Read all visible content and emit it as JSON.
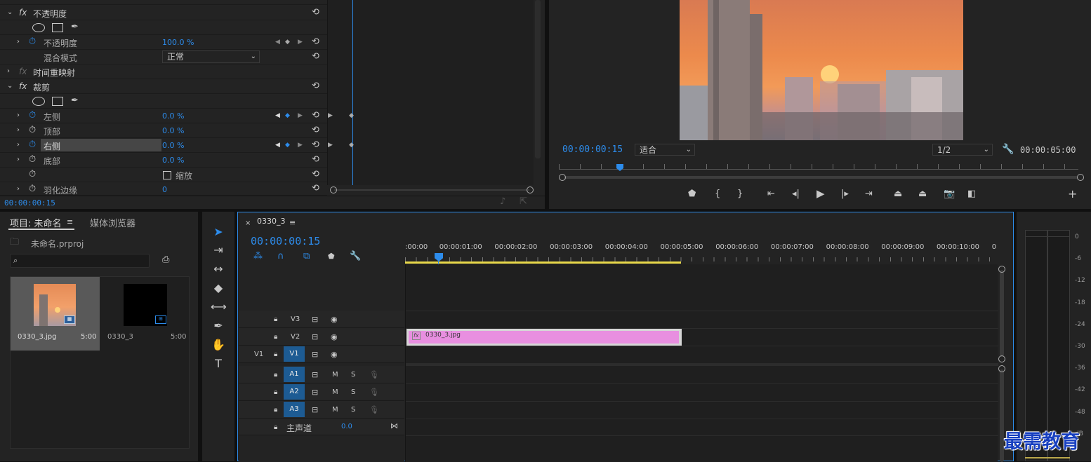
{
  "effects": {
    "top_cut_label": "时间重映射",
    "opacity_section": "不透明度",
    "opacity_label": "不透明度",
    "opacity_value": "100.0 %",
    "blend_label": "混合模式",
    "blend_value": "正常",
    "time_remap": "时间重映射",
    "crop_section": "裁剪",
    "left_label": "左侧",
    "left_value": "0.0 %",
    "top_label": "顶部",
    "top_value": "0.0 %",
    "right_label": "右侧",
    "right_value": "0.0 %",
    "bottom_label": "底部",
    "bottom_value": "0.0 %",
    "zoom_label": "缩放",
    "feather_label": "羽化边缘",
    "feather_value": "0",
    "timecode": "00:00:00:15",
    "fx": "fx"
  },
  "monitor": {
    "timecode": "00:00:00:15",
    "fit": "适合",
    "resolution": "1/2",
    "duration": "00:00:05:00"
  },
  "project": {
    "tab_project": "项目: 未命名",
    "tab_media": "媒体浏览器",
    "file": "未命名.prproj",
    "item1_name": "0330_3.jpg",
    "item1_dur": "5:00",
    "item2_name": "0330_3",
    "item2_dur": "5:00"
  },
  "timeline": {
    "tab": "0330_3",
    "timecode": "00:00:00:15",
    "ruler": [
      ":00:00",
      "00:00:01:00",
      "00:00:02:00",
      "00:00:03:00",
      "00:00:04:00",
      "00:00:05:00",
      "00:00:06:00",
      "00:00:07:00",
      "00:00:08:00",
      "00:00:09:00",
      "00:00:10:00",
      "0"
    ],
    "tracks": {
      "v3": "V3",
      "v2": "V2",
      "v1_src": "V1",
      "v1": "V1",
      "a1": "A1",
      "a2": "A2",
      "a3": "A3",
      "m": "M",
      "s": "S"
    },
    "master": "主声道",
    "master_value": "0.0",
    "clip_name": "0330_3.jpg",
    "clip_fx": "fx"
  },
  "meter": {
    "scale": [
      "0",
      "-6",
      "-12",
      "-18",
      "-24",
      "-30",
      "-36",
      "-42",
      "-48",
      "dB"
    ]
  },
  "watermark": "最需教育",
  "colors": {
    "accent": "#2d8ceb",
    "clip": "#e88fe0",
    "track_blue": "#1d5b93",
    "work_area": "#e8d84a"
  }
}
